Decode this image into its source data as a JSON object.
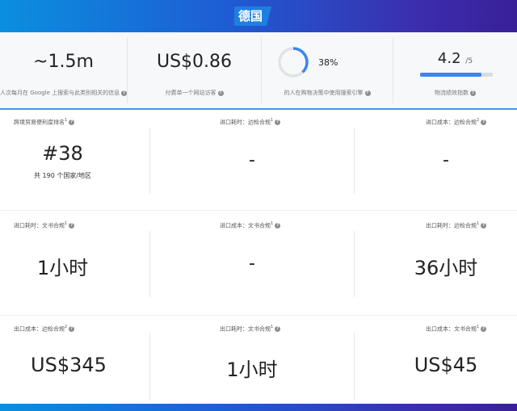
{
  "header": {
    "country": "德国"
  },
  "stats": [
    {
      "value": "~1.5m",
      "desc": "人次每月在 Google 上搜索与此类别相关的信息"
    },
    {
      "value": "US$0.86",
      "desc": "付费单一个网站访客"
    },
    {
      "value": "38%",
      "percent": 38,
      "desc": "的人在购物决策中使用搜索引擎"
    },
    {
      "value": "4.2",
      "max": "/5",
      "rating_fraction": 0.84,
      "desc": "物流绩效指数"
    }
  ],
  "metrics": [
    {
      "label": "跨境贸易便利度排名",
      "sup": "1",
      "value": "#38",
      "sub": "共 190 个国家/地区"
    },
    {
      "label": "进口耗时：边检合规",
      "sup": "1",
      "value": "-"
    },
    {
      "label": "进口成本：边检合规",
      "sup": "2",
      "value": "-"
    },
    {
      "label": "进口耗时：文书合规",
      "sup": "1",
      "value": "1小时"
    },
    {
      "label": "进口成本：文书合规",
      "sup": "1",
      "value": "-"
    },
    {
      "label": "出口耗时：边检合规",
      "sup": "1",
      "value": "36小时"
    },
    {
      "label": "出口成本：边检合规",
      "sup": "2",
      "value": "US$345"
    },
    {
      "label": "出口耗时：文书合规",
      "sup": "1",
      "value": "1小时"
    },
    {
      "label": "出口成本：文书合规",
      "sup": "1",
      "value": "US$45"
    }
  ],
  "colors": {
    "accent": "#3a87ef",
    "donut_track": "#e1e3e6"
  }
}
